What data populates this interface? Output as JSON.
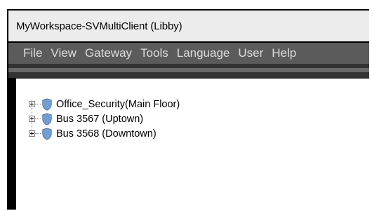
{
  "window": {
    "title": "MyWorkspace-SVMultiClient (Libby)"
  },
  "menubar": {
    "items": [
      "File",
      "View",
      "Gateway",
      "Tools",
      "Language",
      "User",
      "Help"
    ]
  },
  "tree": {
    "nodes": [
      {
        "label": "Office_Security(Main Floor)",
        "icon": "shield-icon"
      },
      {
        "label": "Bus 3567 (Uptown)",
        "icon": "shield-icon"
      },
      {
        "label": "Bus 3568 (Downtown)",
        "icon": "shield-icon"
      }
    ]
  },
  "colors": {
    "menubar_bg": "#5b5b5b",
    "titlebar_bg": "#ececec",
    "shield_blue": "#3a6fb0"
  }
}
